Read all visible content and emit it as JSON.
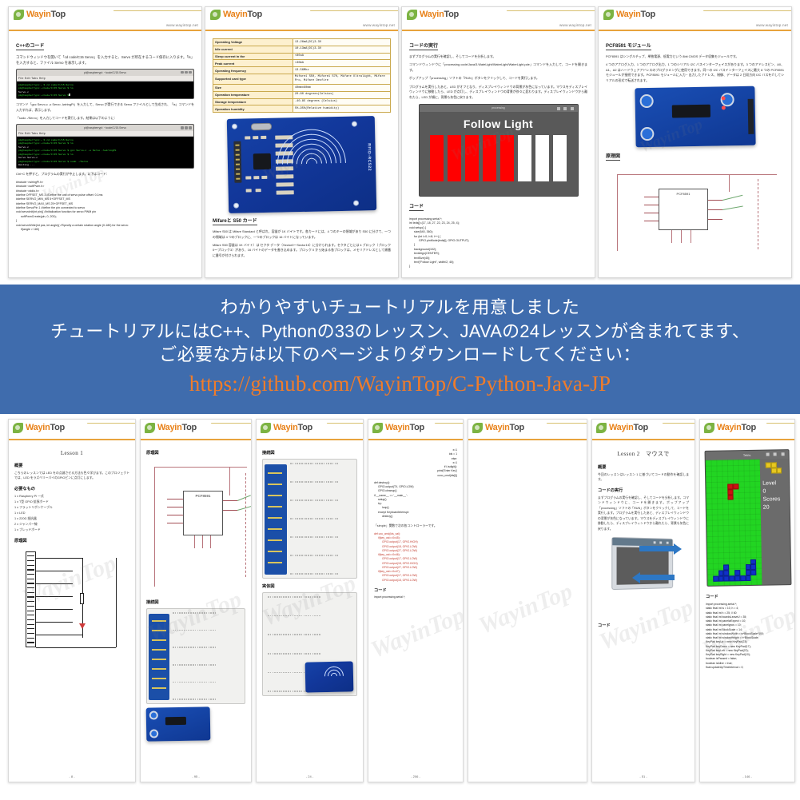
{
  "brand": {
    "name_part1": "Wayin",
    "name_part2": "Top",
    "url": "www.wayintop.net",
    "watermark": "WayinTop"
  },
  "banner": {
    "line1": "わかりやすいチュートリアルを用意しました",
    "line2": "チュートリアルにはC++、Pythonの33のレッスン、JAVAの24レッスンが含まれてます、",
    "line3": "ご必要な方は以下のページよりダウンロードしてください：",
    "url": "https://github.com/WayinTop/C-Python-Java-JP",
    "bg_color": "#3f6cad",
    "url_color": "#f07c2a"
  },
  "top_pages": [
    {
      "id": "cpp-code-page",
      "title": "C++のコード",
      "paras": [
        "コマンドウィンドウを開いて「cd code/C15 Servo」を入力すると、Servo が所在するコード保存に入ります。「ls」を入力すると、ファイル Servo を表示します。",
        "コマンド「gcc Servo.c -o Servo -lwiringPi」を入力して、Servo が実行できる Servo ファイルとして生成され、「ls」コマンドを入力すれば、表示します。",
        "「sudo ./Servo」を入力してコードを実行します。結果は以下のように："
      ],
      "terminal1": {
        "title": "pi@raspberrypi: ~/code/C/15.Servo",
        "menu": "File  Edit  Tabs  Help",
        "lines": [
          "pi@raspberrypi:~ $ cd code/C/15.Servo",
          "pi@raspberrypi:~/code/C/15.Servo $ ls",
          "Servo.c",
          "pi@raspberrypi:~/code/C/15.Servo $"
        ]
      },
      "terminal2": {
        "title": "pi@raspberrypi: ~/code/C/15.Servo",
        "menu": "File  Edit  Tabs  Help",
        "lines": [
          "pi@raspberrypi:~ $ cd code/C/15.Servo",
          "pi@raspberrypi:~/code/C/15.Servo $ ls",
          "Servo.c",
          "pi@raspberrypi:~/code/C/15.Servo $ gcc Servo.c -o Servo -lwiringPi",
          "pi@raspberrypi:~/code/C/15.Servo $ ls",
          "Servo  Servo.c",
          "pi@raspberrypi:~/code/C/15.Servo $ sudo ./Servo",
          "Waiting ..."
        ]
      },
      "code_intro": "Ctrl+C を押すと、プログラムの実行が中止します。以下はコード：",
      "code": [
        "#include <wiringPi.h>",
        "#include <softPwm.h>",
        "#include <stdio.h>",
        "#define OFFSET_MS 3        //Define the unit of servo pulse offset: 0.1ms",
        "#define SERVO_MIN_MS 5+OFFSET_MS",
        "#define SERVO_MAX_MS 25+OFFSET_MS",
        "#define ServoPin 1         //define the pin connected to servo",
        "void servoInit(int pin){   //initialization function for servo PWM pin",
        "    softPwmCreate(pin, 0, 200);",
        "}",
        "void servoWrite(int pos, int angle){   //Specify a certain rotation angle (0-180) for the servo",
        "    if(angle > 180)"
      ]
    },
    {
      "id": "rfid-spec-page",
      "spec_table": [
        {
          "key": "Operating Voltage",
          "value": "13-26mA(DC)3.3V"
        },
        {
          "key": "Idle current",
          "value": "10-13mA(DC)3.3V"
        },
        {
          "key": "Sleep current in the",
          "value": "<80uA"
        },
        {
          "key": "Peak current",
          "value": "<30mA"
        },
        {
          "key": "Operating frequency",
          "value": "13.56Mhz"
        },
        {
          "key": "Supported card type",
          "value": "Mifare1 S50, Mifare1 S70, Mifare Ultralight, Mifare Pro, Mifare Desfire"
        },
        {
          "key": "Size",
          "value": "40mmx60mm"
        },
        {
          "key": "Operation temperature",
          "value": "20-80 degrees(Celsius)"
        },
        {
          "key": "Storage temperature",
          "value": "-40-85 degrees (Celsius)"
        },
        {
          "key": "Operation humidity",
          "value": "5%-95%(Relative humidity)"
        }
      ],
      "board_label": "RFID-RC522",
      "subtitle": "Mifareと S50 カード",
      "paras": [
        "Mifare S50 は Mifare Standard と呼ばれ、容量が 1K バイトです。各カードには、4 つのキーの領域があり S50 に分けて、一つの領域は 4 つのブロックに、一つのブロックは 16 バイトになっています。",
        "Mifare S50 容量は 1K バイト）は セクタ データ（Sector0～Sector15）に分けられます。セクタごとには 4 ブロック（ブロック0～ブロック3）があり、16 バイトのデータを書き込めます。ブロック 0 から始まる各ブロックは、メモリアドレスとして順番に番号が付けられます。"
      ]
    },
    {
      "id": "code-run-page",
      "title": "コードの実行",
      "paras": [
        "まずプログラムの実行を確認し、そしてコードを分析します。",
        "コマンドウィンドウに「processing code/Java/3.WateLight/WaterLight/WaterLight.pde」コマンドを入力して、コードを開きます。",
        "ポップアップ「processing」ソフトの「RUN」ボタンをクリックして、コードを実行します。",
        "プログラムを実行したあと、LED がオフとなり、ディスプレイウィンドウの背景が灰色になっています。マウスをディスプレイウィンドウに移動したら、LED が点灯し、ディスプレイウィンドウの背景が徐々に変わります。ディスプレイウィンドウから離れたら、LED が順に、背景も灰色に戻ります。"
      ],
      "window_title": "Follow Light",
      "window_caption": "processing",
      "bars": [
        "on",
        "on",
        "on",
        "on",
        "on",
        "off",
        "off",
        "off"
      ],
      "code_label": "コード",
      "code": [
        "import processing.serial.*;",
        "",
        "int leds[]={17, 18, 27, 22, 23, 24, 25, 4};",
        "",
        "void setup() {",
        "  size(640, 360);",
        "  for (int i=0; i<8; i++) {",
        "    GPIO.pinMode(leds[i], GPIO.OUTPUT);",
        "  }",
        "  background(102);",
        "  textAlign(CENTER);",
        "  textSize(40);",
        "  text(\"Follow Light\", width/2, 40);",
        "}"
      ]
    },
    {
      "id": "pcf8591-page",
      "title": "PCF8591 モジュール",
      "paras": [
        "PCF8591 はシングルチップ、単独電源、低電力という 8bit CMOS データ収集モジュールです。",
        "4 つのアナログ入力、1 つのアナログ出力、1 つのシリアル I2C バスインターフェイスがあります。3 つのアドレスピン、A0、A1、A2 はハードウェアアドレスのプログラミングに使用できます。同一の I2C バスインターフェイスに最大 8 つの PCF8591 モジュールが接続できます。PCF8591 モジュールに入力・出力したアドレス、制御、データは 2 日双方向 I2C バスを介してシリアルの形式で転送されます。"
      ],
      "schem_label": "原理図",
      "chip_label": "PCF8591"
    }
  ],
  "bottom_pages": [
    {
      "id": "lesson1-page",
      "lesson": "Lesson 1",
      "sections": [
        {
          "heading": "概要",
          "text": "こちらのレッスンでは LED をの点滅させる方法も色々学びます。このプロジェクトでは、LED をラズベリーパイのGPIOピンに点灯にします。"
        },
        {
          "heading": "必要なもの",
          "items": [
            "1 x Raspberry Pi 一式",
            "1 x T型 GPIO 拡張ボード",
            "1 x フラットリボンケーブル",
            "1 x LED",
            "1 x 220Ω 抵抗器",
            "2 x ジャンパー線",
            "1 x ブレッドボード"
          ]
        },
        {
          "heading": "原理図",
          "text": ""
        }
      ],
      "page_number": "- 8 -"
    },
    {
      "id": "pcf8591-schematic-page",
      "sections": [
        {
          "heading": "原理図",
          "text": ""
        },
        {
          "heading": "接続図",
          "text": ""
        }
      ],
      "chip_label": "PCF8591",
      "page_number": "- 95 -"
    },
    {
      "id": "wiring-page",
      "sections": [
        {
          "heading": "接続図",
          "text": ""
        },
        {
          "heading": "実体図",
          "text": ""
        }
      ],
      "page_number": "- 24 -"
    },
    {
      "id": "python-code-page",
      "code_label": "コード",
      "code": [
        "x=1",
        "ids = 1",
        "else:",
        "    x=1",
        "    if i.isdigit():",
        "        print('Enter Key')",
        "        czoo_cmd(ids[i])",
        "",
        "def destroy():",
        "    GPIO.output(TX, GPIO.LOW)",
        "    GPIO.cleanup()",
        "",
        "if __name__ == '__main__':",
        "    setup()",
        "    try:",
        "        loop()",
        "    except KeyboardInterrupt:",
        "        destroy()"
      ],
      "code2": [
        "def czo_cmd(ids_val):",
        "    if(key_val==0x45):",
        "        GPIO.output(17, GPIO.HIGH)",
        "        GPIO.output(18, GPIO.LOW)",
        "        GPIO.output(27, GPIO.LOW)",
        "    if(key_val==0x46):",
        "        GPIO.output(17, GPIO.LOW)",
        "        GPIO.output(18, GPIO.HIGH)",
        "        GPIO.output(27, GPIO.LOW)",
        "    if(key_val==0x47):",
        "        GPIO.output(17, GPIO.LOW)",
        "        GPIO.output(18, GPIO.LOW)"
      ],
      "note": "「simple」関数で次の各コントローラーです。",
      "footer_code": "import processing.serial.*;",
      "page_number": "- 206 -"
    },
    {
      "id": "lesson2-page",
      "lesson": "Lesson 2　マウスで",
      "sections": [
        {
          "heading": "概要",
          "text": "今回のレッスンはレッスン 1 に基づいてコードの動作を確認します。"
        },
        {
          "heading": "コードの実行",
          "text": "まずプログラムの実行を確認し、そしてコードを分析します。コマンドウィンドウに、コードを開きます。ポップアップ「processing」ソフトの「RUN」ボタンをクリックして、コードを実行します。プログラムを実行したあと、ディスプレイウィンドウの背景が灰色になっています。マウスをディスプレイウィンドウに移動したら、ディスプレイウィンドウから離れたら、背景も灰色に戻ります。"
        }
      ],
      "code_label": "コード",
      "page_number": "- 51 -"
    },
    {
      "id": "tetris-page",
      "game": {
        "window_title": "Tetris",
        "level_label": "Level",
        "level_value": "0",
        "scores_label": "Scores",
        "scores_value": "20"
      },
      "code_label": "コード",
      "code": [
        "import processing.serial.*;",
        "",
        "static final int w = 10, h = 4;",
        "static final int h = 25; // 60",
        "static final int boardsLeaveU = 35;",
        "static final int panelwExpect = 10;",
        "static final int panelypos = 10;",
        "static final int BlockScale = 14;",
        "static final int windowWidth = w*BlockScale*100;",
        "static final int windowHeight = h*BlockScale;",
        "",
        "KeyPad keyUp = new KeyPad(23);",
        "KeyPad keyDown = new KeyPad(17);",
        "KeyPad keyLeft = new KeyPad(22);",
        "KeyPad keyRight = new KeyPad(10);",
        "",
        "boolean isPaused = false;",
        "boolean isAlive = true;",
        "float updateUpTimeInterval = 0;"
      ],
      "page_number": "- 146 -"
    }
  ]
}
